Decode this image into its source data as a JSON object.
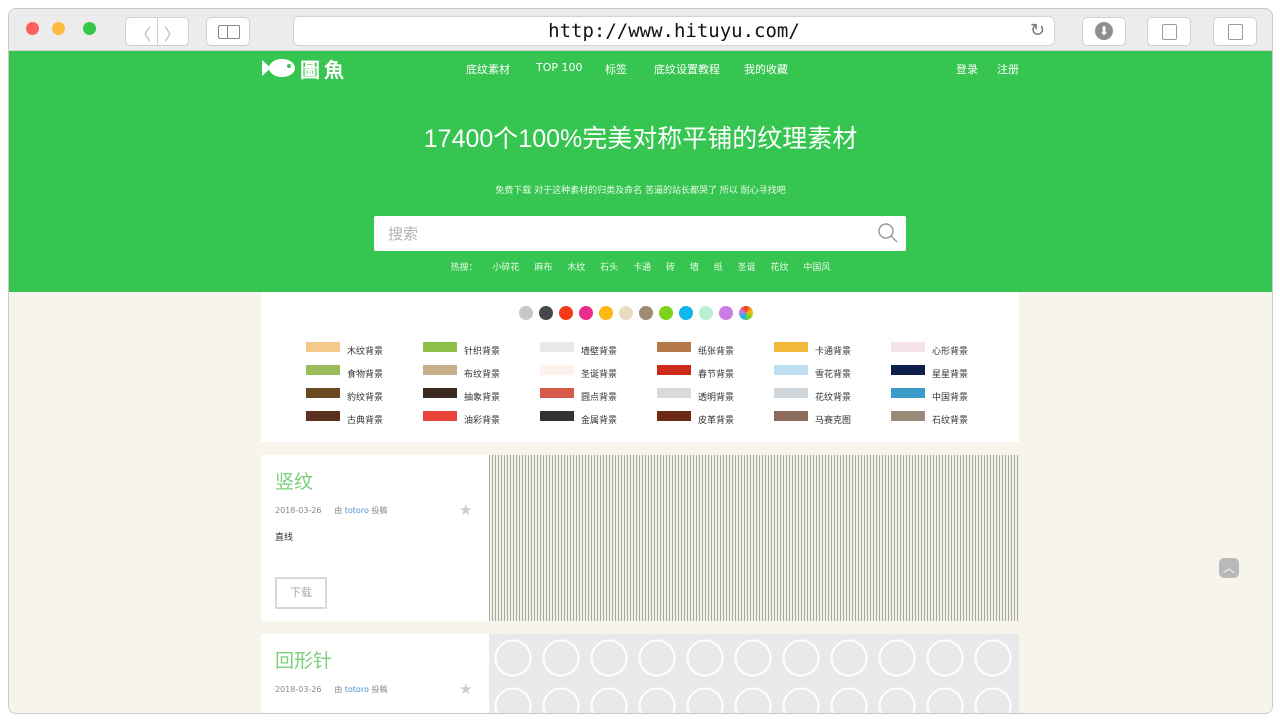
{
  "browser": {
    "url": "http://www.hituyu.com/"
  },
  "header": {
    "logo_text": "圖魚",
    "nav": [
      "底纹素材",
      "TOP 100",
      "标签",
      "底纹设置教程",
      "我的收藏"
    ],
    "login": "登录",
    "register": "注册"
  },
  "hero": {
    "title": "17400个100%完美对称平铺的纹理素材",
    "subtitle": "免费下载 对于这种素材的归类及命名 苦逼的站长都哭了 所以 耐心寻找吧",
    "search_placeholder": "搜索",
    "hot_label": "热搜：",
    "hot_terms": [
      "小碎花",
      "麻布",
      "木纹",
      "石头",
      "卡通",
      "砖",
      "墙",
      "纸",
      "圣诞",
      "花纹",
      "中国风"
    ]
  },
  "colors": [
    "#c7c7c7",
    "#474747",
    "#f23a17",
    "#ec2b8c",
    "#fdb913",
    "#e8dcc0",
    "#a08a74",
    "#7ed321",
    "#10b7ef",
    "#b7f0d2",
    "#c97be6",
    "rainbow"
  ],
  "categories": [
    [
      "木纹背景",
      "针织背景",
      "墙壁背景",
      "纸张背景",
      "卡通背景",
      "心形背景"
    ],
    [
      "食物背景",
      "布纹背景",
      "圣诞背景",
      "春节背景",
      "雪花背景",
      "星星背景"
    ],
    [
      "豹纹背景",
      "抽象背景",
      "圆点背景",
      "透明背景",
      "花纹背景",
      "中国背景"
    ],
    [
      "古典背景",
      "油彩背景",
      "金属背景",
      "皮革背景",
      "马赛克图",
      "石纹背景"
    ]
  ],
  "thumb_colors": [
    [
      "#f4c98a",
      "#8bbf4a",
      "#e6e8ea",
      "#b57a4a",
      "#f2b83a",
      "#f6e2ea"
    ],
    [
      "#9bbc5a",
      "#c8b08a",
      "#fff1ec",
      "#cc2a1a",
      "#bfe0f2",
      "#0d1f4a"
    ],
    [
      "#6b4a22",
      "#3b2a1f",
      "#d65a4a",
      "#dadada",
      "#cfd6dc",
      "#3a9cc8"
    ],
    [
      "#5a3020",
      "#e8423a",
      "#333333",
      "#6a2a14",
      "#8a6a5a",
      "#9a8a7a"
    ]
  ],
  "cards": [
    {
      "title": "竖纹",
      "date": "2018-03-26",
      "by": "由",
      "author": "totoro",
      "contrib": "投稿",
      "desc": "直线",
      "download": "下载"
    },
    {
      "title": "回形针",
      "date": "2018-03-26",
      "by": "由",
      "author": "totoro",
      "contrib": "投稿"
    }
  ]
}
